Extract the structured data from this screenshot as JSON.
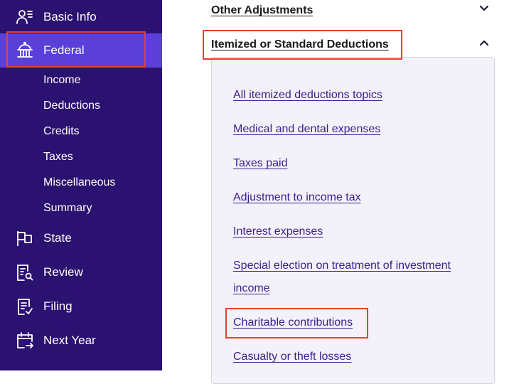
{
  "sidebar": {
    "items": [
      {
        "label": "Basic Info",
        "icon": "user-list-icon"
      },
      {
        "label": "Federal",
        "icon": "capitol-icon",
        "active": true
      },
      {
        "label": "State",
        "icon": "flag-icon"
      },
      {
        "label": "Review",
        "icon": "document-search-icon"
      },
      {
        "label": "Filing",
        "icon": "document-check-icon"
      },
      {
        "label": "Next Year",
        "icon": "calendar-arrow-icon"
      }
    ],
    "sub_items": [
      "Income",
      "Deductions",
      "Credits",
      "Taxes",
      "Miscellaneous",
      "Summary"
    ]
  },
  "main": {
    "sections": [
      {
        "title": "Other Adjustments",
        "expanded": false
      },
      {
        "title": "Itemized or Standard Deductions",
        "expanded": true
      }
    ],
    "links": [
      "All itemized deductions topics",
      "Medical and dental expenses",
      "Taxes paid",
      "Adjustment to income tax",
      "Interest expenses",
      "Special election on treatment of investment income",
      "Charitable contributions",
      "Casualty or theft losses"
    ]
  },
  "colors": {
    "sidebar_bg": "#2b1170",
    "active_bg": "#5a3fd8",
    "link": "#3b1f8c",
    "highlight": "#e8402f"
  }
}
